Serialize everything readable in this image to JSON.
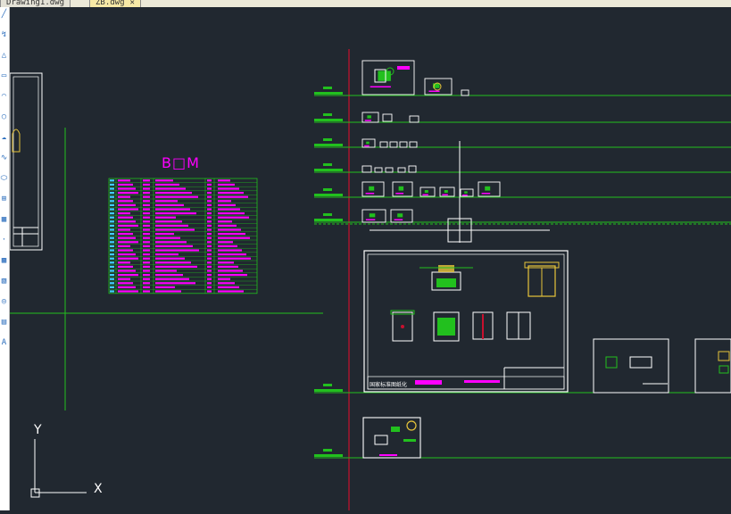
{
  "tabs": [
    {
      "label": "Drawing1.dwg",
      "active": false
    },
    {
      "label": "ZB.dwg",
      "active": true,
      "close_glyph": "✕"
    }
  ],
  "toolbar_icons": [
    "line-icon",
    "polyline-icon",
    "polygon-icon",
    "rectangle-icon",
    "arc-icon",
    "circle-icon",
    "cloud-icon",
    "spline-icon",
    "ellipse-icon",
    "insert-icon",
    "block-icon",
    "point-icon",
    "hatch-icon",
    "gradient-icon",
    "region-icon",
    "table-icon",
    "text-icon"
  ],
  "drawing": {
    "bom_title": "B□M",
    "title_block_text": "国家标准图纸化"
  },
  "ucs": {
    "x_label": "X",
    "y_label": "Y"
  },
  "colors": {
    "background": "#212830",
    "green": "#22c01e",
    "red": "#c8102e",
    "white": "#ffffff",
    "magenta": "#ff00ff",
    "yellow": "#e8c53a",
    "cyan": "#3fd2ff"
  }
}
